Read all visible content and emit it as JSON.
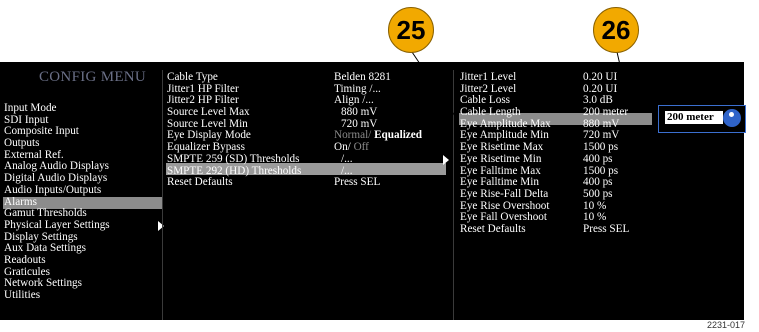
{
  "menu_title": "CONFIG MENU",
  "main_menu": [
    "Input Mode",
    "SDI Input",
    "Composite Input",
    "Outputs",
    "External Ref.",
    "Analog Audio Displays",
    "Digital Audio Displays",
    "Audio Inputs/Outputs",
    "Alarms",
    "Gamut Thresholds",
    "Physical Layer Settings",
    "Display Settings",
    "Aux Data Settings",
    "Readouts",
    "Graticules",
    "Network Settings",
    "Utilities"
  ],
  "submenu": [
    {
      "label": "Cable Type",
      "value": "Belden 8281"
    },
    {
      "label": "Jitter1 HP Filter",
      "value": "Timing /..."
    },
    {
      "label": "Jitter2 HP Filter",
      "value": "Align /..."
    },
    {
      "label": "Source Level Max",
      "value": "880 mV"
    },
    {
      "label": "Source Level Min",
      "value": "720 mV"
    },
    {
      "label": "Eye Display Mode",
      "value_dim": "Normal/",
      "value": "Equalized"
    },
    {
      "label": "Equalizer Bypass",
      "value": "On/",
      "value_dim": "Off"
    },
    {
      "label": "SMPTE 259 (SD) Thresholds",
      "value": "/..."
    },
    {
      "label": "SMPTE 292 (HD) Thresholds",
      "value": "/..."
    },
    {
      "label": "Reset Defaults",
      "value": "Press SEL"
    }
  ],
  "thresholds": [
    {
      "label": "Jitter1 Level",
      "value": "0.20 UI"
    },
    {
      "label": "Jitter2 Level",
      "value": "0.20 UI"
    },
    {
      "label": "Cable Loss",
      "value": "3.0 dB"
    },
    {
      "label": "Cable Length",
      "value": "200 meter"
    },
    {
      "label": "Eye Amplitude Max",
      "value": "880 mV"
    },
    {
      "label": "Eye Amplitude Min",
      "value": "720 mV"
    },
    {
      "label": "Eye Risetime Max",
      "value": "1500 ps"
    },
    {
      "label": "Eye Risetime Min",
      "value": "400 ps"
    },
    {
      "label": "Eye Falltime Max",
      "value": "1500 ps"
    },
    {
      "label": "Eye Falltime Min",
      "value": "400 ps"
    },
    {
      "label": "Eye Rise-Fall Delta",
      "value": "500 ps"
    },
    {
      "label": "Eye Rise Overshoot",
      "value": "10 %"
    },
    {
      "label": "Eye Fall Overshoot",
      "value": "10 %"
    },
    {
      "label": "Reset Defaults",
      "value": "Press SEL"
    }
  ],
  "popup_value": "200 meter",
  "callouts": [
    "25",
    "26"
  ],
  "figure_id": "2231-017",
  "colors": {
    "highlight": "#8e8e8e",
    "accent": "#2f63c9",
    "callout": "#f2a900"
  }
}
